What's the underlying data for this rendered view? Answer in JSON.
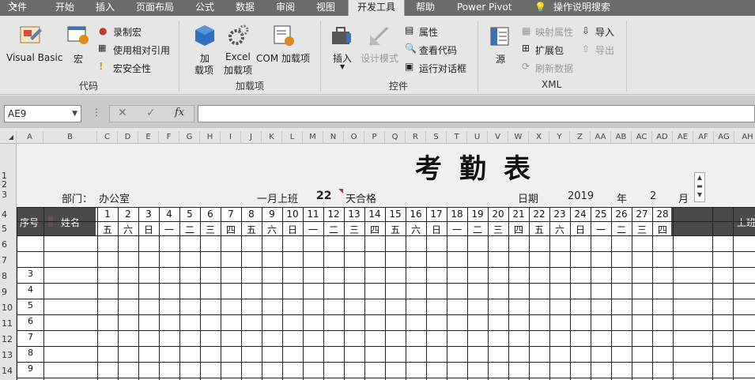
{
  "menu": {
    "tabs": [
      "文件",
      "开始",
      "插入",
      "页面布局",
      "公式",
      "数据",
      "审阅",
      "视图",
      "开发工具",
      "帮助",
      "Power Pivot",
      "操作说明搜索"
    ],
    "active": "开发工具"
  },
  "ribbon": {
    "code": {
      "visual_basic": "Visual Basic",
      "macros": "宏",
      "record_macro": "录制宏",
      "relative_ref": "使用相对引用",
      "macro_security": "宏安全性",
      "group": "代码"
    },
    "addins": {
      "addins_l1": "加",
      "addins_l2": "载项",
      "excel_l1": "Excel",
      "excel_l2": "加载项",
      "com": "COM 加载项",
      "group": "加载项"
    },
    "controls": {
      "insert": "插入",
      "design_mode": "设计模式",
      "properties": "属性",
      "view_code": "查看代码",
      "run_dialog": "运行对话框",
      "group": "控件"
    },
    "xml": {
      "source": "源",
      "map_props": "映射属性",
      "expansion": "扩展包",
      "refresh": "刷新数据",
      "import": "导入",
      "export": "导出",
      "group": "XML"
    }
  },
  "formula_bar": {
    "name_box": "AE9",
    "cancel": "✕",
    "enter": "✓",
    "fx": "fx",
    "content": ""
  },
  "columns": [
    "A",
    "B",
    "C",
    "D",
    "E",
    "F",
    "G",
    "H",
    "I",
    "J",
    "K",
    "L",
    "M",
    "N",
    "O",
    "P",
    "Q",
    "R",
    "S",
    "T",
    "U",
    "V",
    "W",
    "X",
    "Y",
    "Z",
    "AA",
    "AB",
    "AC",
    "AD",
    "AE",
    "AF",
    "AG",
    "AH"
  ],
  "rows": [
    "1",
    "2",
    "3",
    "4",
    "5",
    "6",
    "7",
    "8",
    "9",
    "10",
    "11",
    "12",
    "13",
    "14"
  ],
  "sheet": {
    "title": "考勤表",
    "dept_label": "部门：",
    "dept_value": "办公室",
    "month_work_label": "一月上班",
    "month_work_days": "22",
    "pass_label": "天合格",
    "date_label": "日期",
    "year": "2019",
    "year_label": "年",
    "month": "2",
    "month_label": "月",
    "header_no": "序号",
    "header_name": "姓名",
    "header_right": "上班",
    "days": [
      "1",
      "2",
      "3",
      "4",
      "5",
      "6",
      "7",
      "8",
      "9",
      "10",
      "11",
      "12",
      "13",
      "14",
      "15",
      "16",
      "17",
      "18",
      "19",
      "20",
      "21",
      "22",
      "23",
      "24",
      "25",
      "26",
      "27",
      "28"
    ],
    "weekdays": [
      "五",
      "六",
      "日",
      "一",
      "二",
      "三",
      "四",
      "五",
      "六",
      "日",
      "一",
      "二",
      "三",
      "四",
      "五",
      "六",
      "日",
      "一",
      "二",
      "三",
      "四",
      "五",
      "六",
      "日",
      "一",
      "二",
      "三",
      "四"
    ],
    "serials": [
      "3",
      "4",
      "5",
      "6",
      "7",
      "8",
      "9"
    ]
  }
}
